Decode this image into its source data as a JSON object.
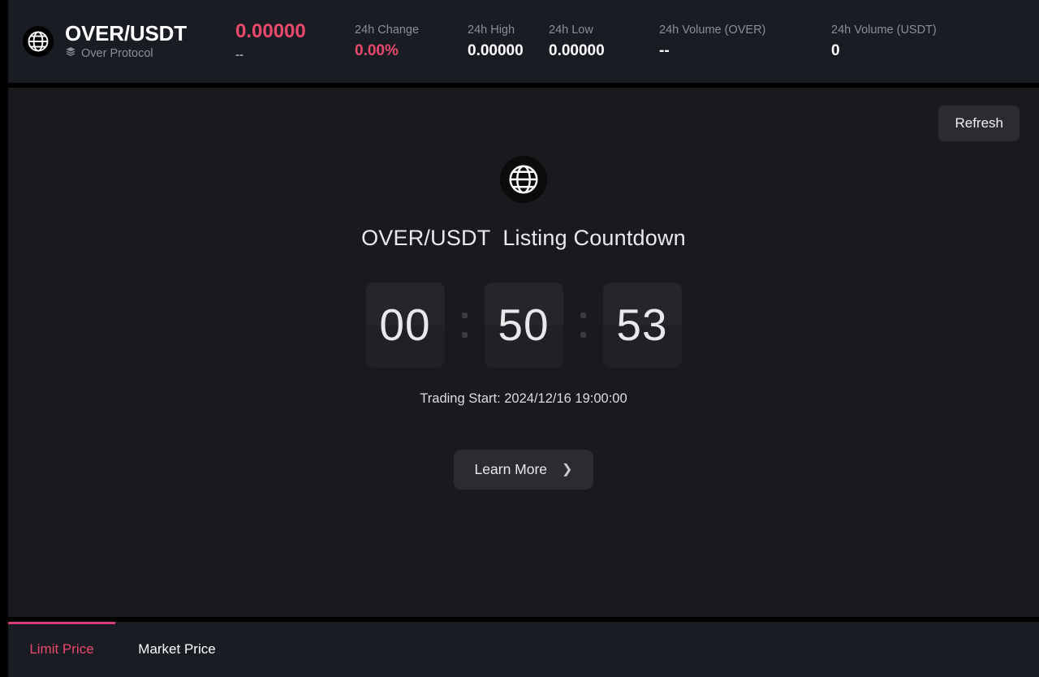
{
  "ticker": {
    "coin_icon": "globe-icon",
    "pair": "OVER/USDT",
    "project_icon": "layers-icon",
    "project_name": "Over Protocol",
    "price": "0.00000",
    "price_sub": "--",
    "stats": [
      {
        "label": "24h Change",
        "value": "0.00%"
      },
      {
        "label": "24h High",
        "value": "0.00000"
      },
      {
        "label": "24h Low",
        "value": "0.00000"
      },
      {
        "label": "24h Volume (OVER)",
        "value": "--"
      },
      {
        "label": "24h Volume (USDT)",
        "value": "0"
      }
    ]
  },
  "content": {
    "refresh_label": "Refresh",
    "globe_icon": "globe-icon",
    "countdown_title": "OVER/USDT  Listing Countdown",
    "countdown": {
      "hours": "00",
      "minutes": "50",
      "seconds": "53"
    },
    "trading_start": "Trading Start: 2024/12/16 19:00:00",
    "learn_more_label": "Learn More",
    "learn_more_chevron": "chevron-right-icon"
  },
  "tabs": [
    {
      "label": "Limit Price",
      "active": true
    },
    {
      "label": "Market Price",
      "active": false
    }
  ],
  "colors": {
    "accent_down": "#e8496d",
    "tab_indicator": "#d63a78",
    "panel_bg": "#191a1d",
    "header_bg": "#1a1c23"
  }
}
